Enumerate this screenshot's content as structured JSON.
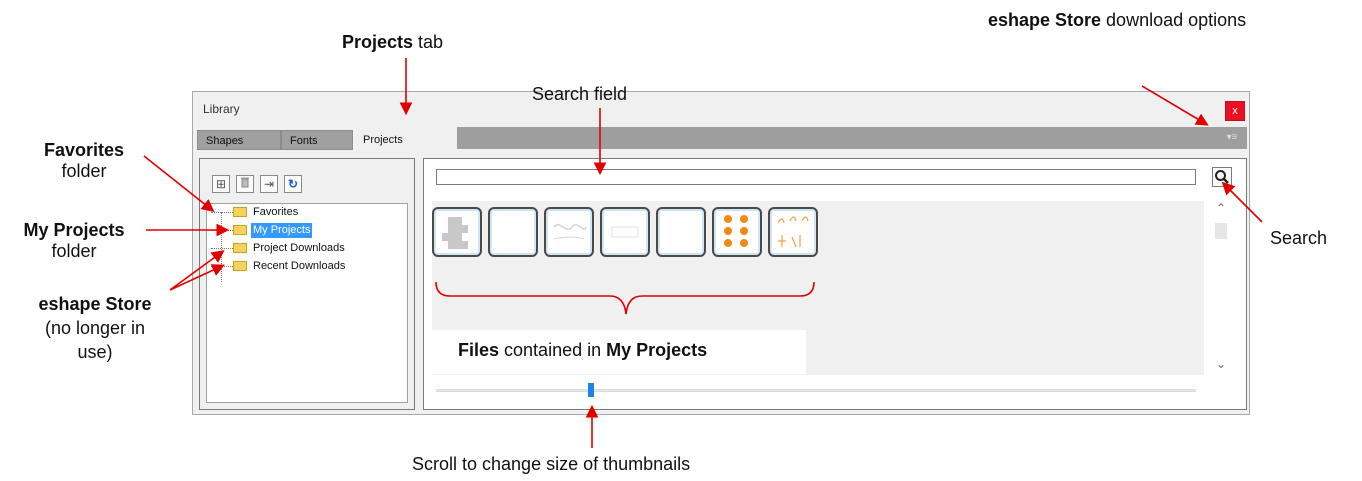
{
  "window": {
    "title": "Library",
    "close_label": "x"
  },
  "tabs": [
    {
      "label": "Shapes",
      "active": false
    },
    {
      "label": "Fonts",
      "active": false
    },
    {
      "label": "Projects",
      "active": true
    }
  ],
  "store_menu_icon": "dropdown-menu-icon",
  "toolbar": [
    {
      "name": "new-folder-button",
      "icon": "new-folder-icon",
      "glyph": "⊞"
    },
    {
      "name": "delete-button",
      "icon": "trash-icon",
      "glyph": "🗑"
    },
    {
      "name": "import-button",
      "icon": "import-icon",
      "glyph": "⇥"
    },
    {
      "name": "refresh-button",
      "icon": "refresh-icon",
      "glyph": "↻"
    }
  ],
  "tree": {
    "items": [
      {
        "label": "Favorites",
        "selected": false
      },
      {
        "label": "My Projects",
        "selected": true
      },
      {
        "label": "Project Downloads",
        "selected": false
      },
      {
        "label": "Recent Downloads",
        "selected": false
      }
    ]
  },
  "search": {
    "value": "",
    "placeholder": "",
    "button_icon": "search-icon"
  },
  "thumbnails_count": 7,
  "thumbnail_size_level": 0.2,
  "annotations": {
    "projects_tab": {
      "bold": "Projects",
      "rest": " tab"
    },
    "search_field": "Search field",
    "store_options": {
      "bold": "eshape Store",
      "rest": " download options"
    },
    "favorites": {
      "bold": "Favorites",
      "line2": "folder"
    },
    "my_projects": {
      "bold": "My Projects",
      "line2": "folder"
    },
    "eshape_store": {
      "bold": "eshape Store",
      "line2": "(no longer in",
      "line3": "use)"
    },
    "search": "Search",
    "files": {
      "bold1": "Files",
      "mid": " contained in ",
      "bold2": "My Projects"
    },
    "scroll": "Scroll to change size of thumbnails"
  },
  "colors": {
    "arrow": "#e00000",
    "selection": "#3399ff",
    "folder": "#f5d35a",
    "close": "#e81123",
    "slider": "#1a83e6"
  }
}
